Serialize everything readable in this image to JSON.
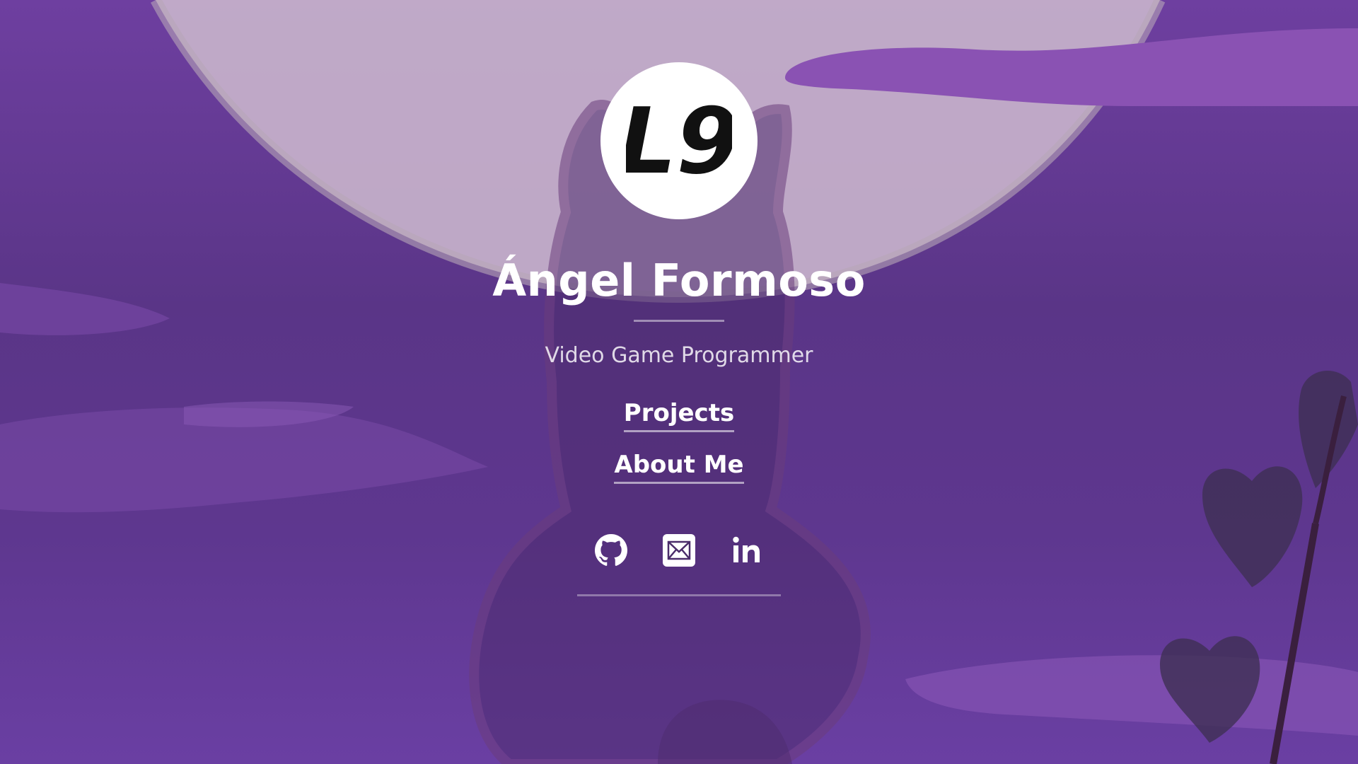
{
  "profile": {
    "logo_text": "L9",
    "name": "Ángel Formoso",
    "title": "Video Game Programmer"
  },
  "nav": {
    "projects_label": "Projects",
    "about_label": "About Me"
  },
  "social": {
    "icons": [
      "github-icon",
      "mail-icon",
      "linkedin-icon"
    ]
  },
  "colors": {
    "background": "#5e378f",
    "moon": "#c9b3cf",
    "text": "#ffffff"
  }
}
